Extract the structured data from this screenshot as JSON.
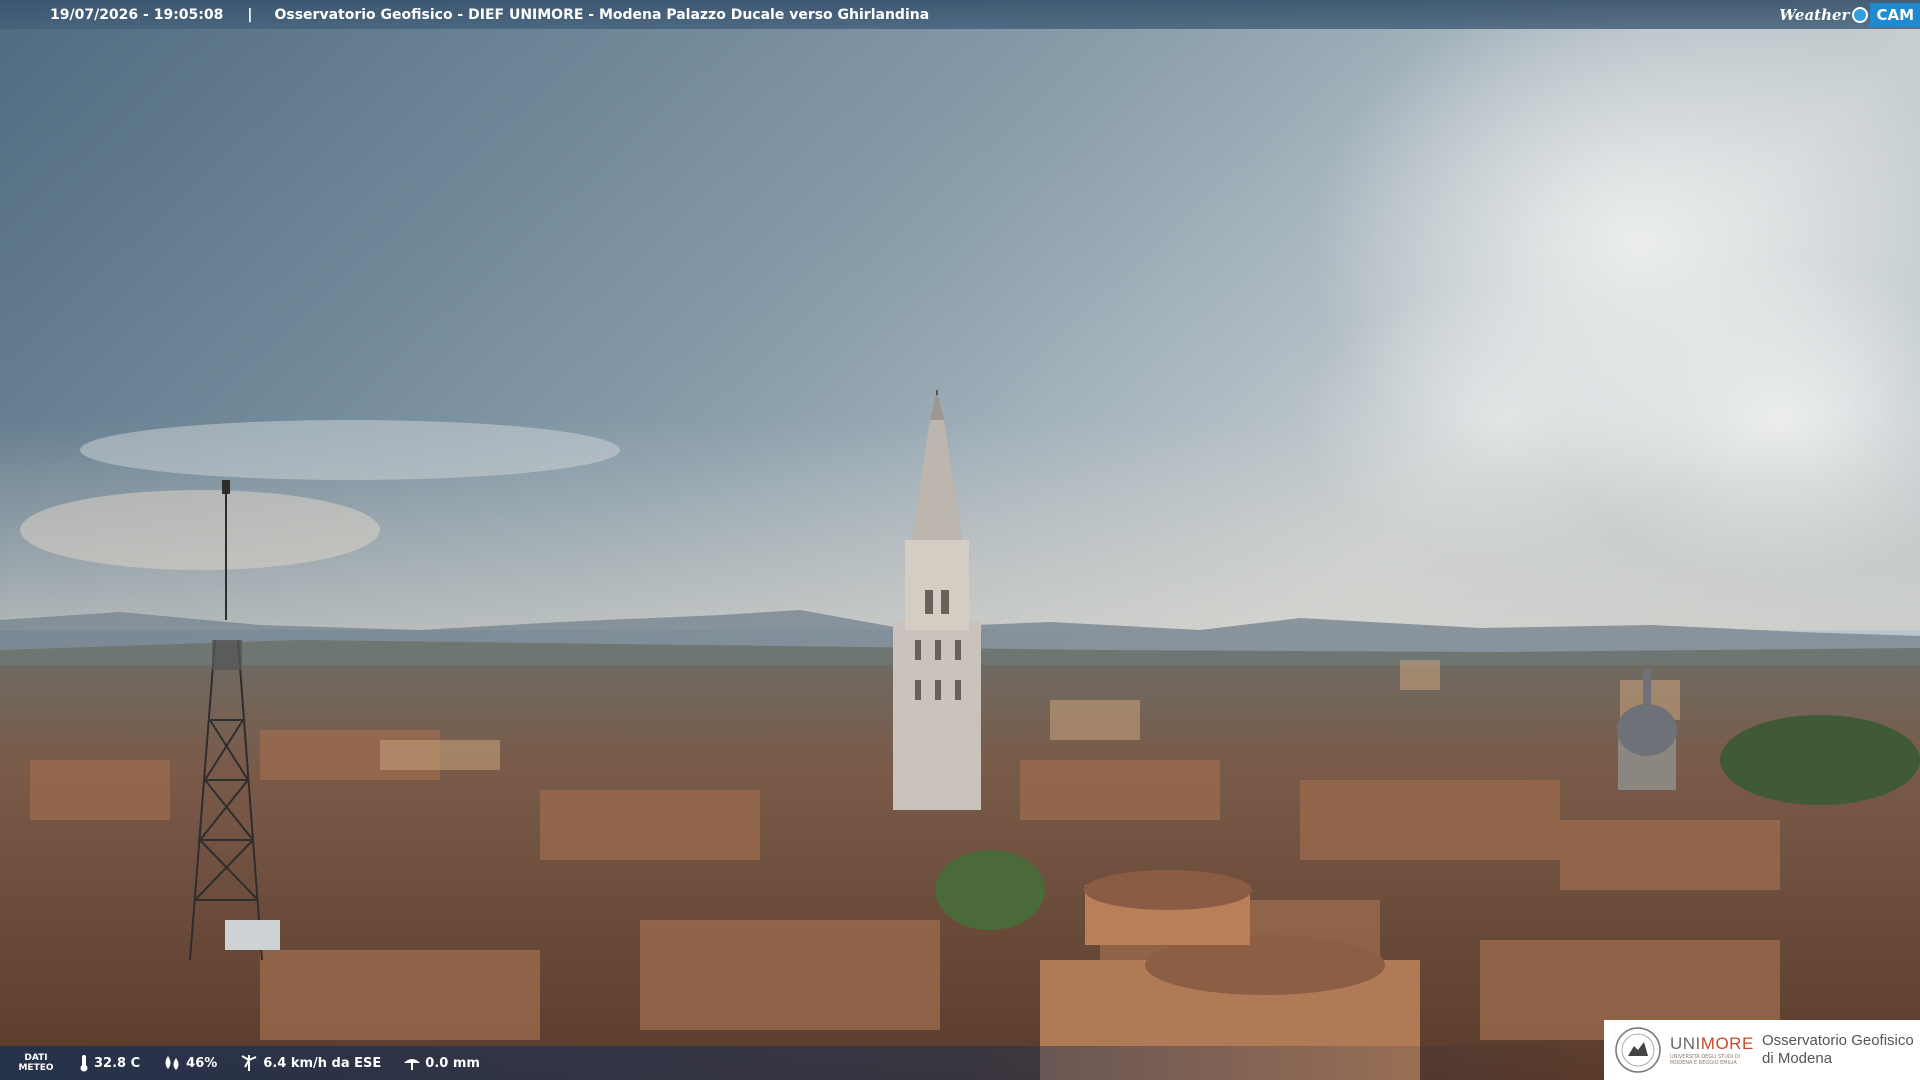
{
  "header": {
    "timestamp": "19/07/2026 - 19:05:08",
    "separator": "|",
    "title": "Osservatorio Geofisico - DIEF UNIMORE - Modena Palazzo Ducale verso Ghirlandina"
  },
  "brand": {
    "weather": "Weather",
    "cam": "CAM"
  },
  "footer": {
    "dati_line1": "DATI",
    "dati_line2": "METEO",
    "temperature": "32.8 C",
    "humidity": "46%",
    "wind": "6.4 km/h da ESE",
    "rain": "0.0 mm",
    "icons": [
      "thermometer-icon",
      "humidity-icon",
      "wind-icon",
      "rain-gauge-icon"
    ]
  },
  "logo": {
    "uni_a": "UNI",
    "uni_b": "MORE",
    "uni_sub1": "UNIVERSITÀ DEGLI STUDI DI",
    "uni_sub2": "MODENA E REGGIO EMILIA",
    "obs_line1": "Osservatorio Geofisico",
    "obs_line2": "di Modena"
  },
  "colors": {
    "sky_top": "#4f6a80",
    "sky_light": "#c8cfd2",
    "roofs": "#8a5a40",
    "unimore_red": "#c94a2a",
    "cam_blue": "#1f8ad0"
  }
}
